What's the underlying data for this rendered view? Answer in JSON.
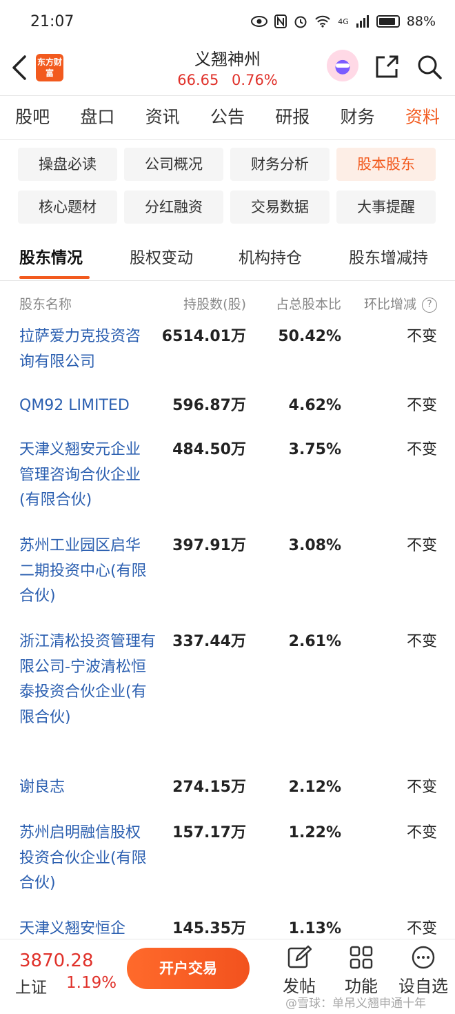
{
  "status_bar": {
    "time": "21:07",
    "network": "4G",
    "battery": "88%"
  },
  "header": {
    "logo_text": "东方财富",
    "stock_name": "义翘神州",
    "price": "66.65",
    "change_pct": "0.76%"
  },
  "main_tabs": [
    "股吧",
    "盘口",
    "资讯",
    "公告",
    "研报",
    "财务",
    "资料"
  ],
  "sub_tabs": [
    "操盘必读",
    "公司概况",
    "财务分析",
    "股本股东",
    "核心题材",
    "分红融资",
    "交易数据",
    "大事提醒"
  ],
  "inner_tabs": [
    "股东情况",
    "股权变动",
    "机构持仓",
    "股东增减持"
  ],
  "table": {
    "headers": {
      "name": "股东名称",
      "shares": "持股数(股)",
      "ratio": "占总股本比",
      "change": "环比增减"
    },
    "rows": [
      {
        "name": "拉萨爱力克投资咨询有限公司",
        "shares": "6514.01万",
        "ratio": "50.42%",
        "change": "不变"
      },
      {
        "name": "QM92 LIMITED",
        "shares": "596.87万",
        "ratio": "4.62%",
        "change": "不变"
      },
      {
        "name": "天津义翘安元企业管理咨询合伙企业(有限合伙)",
        "shares": "484.50万",
        "ratio": "3.75%",
        "change": "不变"
      },
      {
        "name": "苏州工业园区启华二期投资中心(有限合伙)",
        "shares": "397.91万",
        "ratio": "3.08%",
        "change": "不变"
      },
      {
        "name": "浙江清松投资管理有限公司-宁波清松恒泰投资合伙企业(有限合伙)",
        "shares": "337.44万",
        "ratio": "2.61%",
        "change": "不变"
      },
      {
        "name": "谢良志",
        "shares": "274.15万",
        "ratio": "2.12%",
        "change": "不变"
      },
      {
        "name": "苏州启明融信股权投资合伙企业(有限合伙)",
        "shares": "157.17万",
        "ratio": "1.22%",
        "change": "不变"
      },
      {
        "name": "天津义翘安恒企",
        "shares": "145.35万",
        "ratio": "1.13%",
        "change": "不变"
      }
    ]
  },
  "bottom_bar": {
    "index_value": "3870.28",
    "index_name": "上证",
    "index_pct": "1.19%",
    "open_button": "开户交易",
    "actions": [
      "发帖",
      "功能",
      "设自选"
    ],
    "watermark": "@雪球：单吊义翘申通十年"
  },
  "colors": {
    "accent": "#f25a1e",
    "up": "#e0312a",
    "link": "#2b5fb0"
  }
}
